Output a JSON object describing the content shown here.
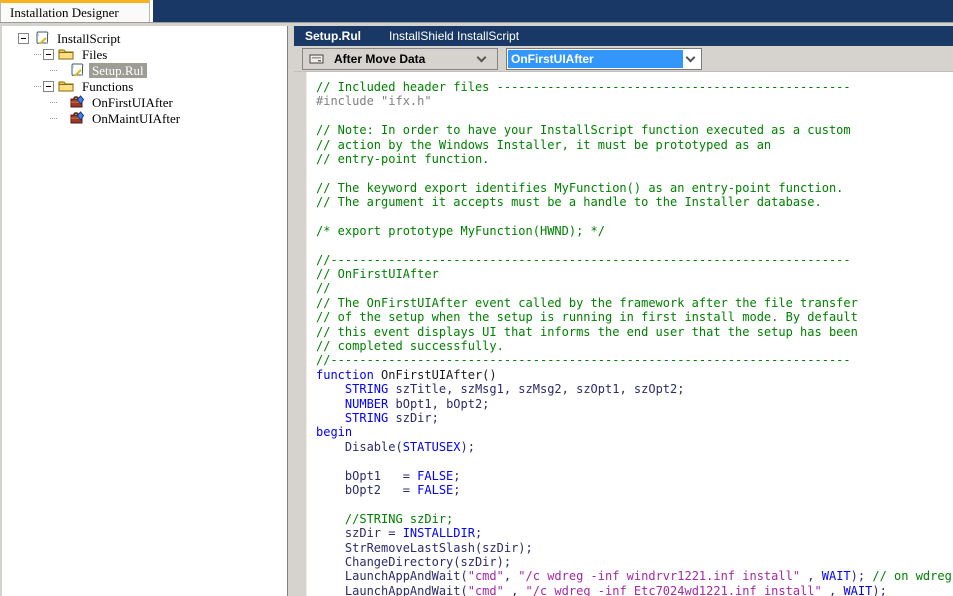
{
  "tab_bar": {
    "tab_label": "Installation Designer"
  },
  "tree": {
    "rows": [
      {
        "level": 0,
        "expand": true,
        "icon": "script-icon",
        "label": "InstallScript",
        "selected": false
      },
      {
        "level": 1,
        "expand": true,
        "icon": "folder-icon",
        "label": "Files",
        "selected": false
      },
      {
        "level": 2,
        "expand": false,
        "icon": "script-icon",
        "label": "Setup.Rul",
        "selected": true
      },
      {
        "level": 1,
        "expand": true,
        "icon": "folder-icon",
        "label": "Functions",
        "selected": false
      },
      {
        "level": 2,
        "expand": false,
        "icon": "function-icon",
        "label": "OnFirstUIAfter",
        "selected": false
      },
      {
        "level": 2,
        "expand": false,
        "icon": "function-icon",
        "label": "OnMaintUIAfter",
        "selected": false
      }
    ]
  },
  "doc_header": {
    "title": "Setup.Rul",
    "subtitle": "InstallShield InstallScript"
  },
  "toolbar": {
    "event_combo": {
      "icon": "event-icon",
      "label": "After Move Data"
    },
    "function_combo": {
      "value": "OnFirstUIAfter"
    }
  },
  "colors": {
    "navy": "#1a3866",
    "tab_accent": "#f9b11c",
    "toolbar_gray": "#d6d3ce",
    "sel_blue": "#3296fa",
    "tree_sel": "#9d9d95",
    "code_comment": "#008000",
    "code_preproc": "#808080",
    "code_keyword": "#0000ff",
    "code_ident": "#2b2b6b",
    "code_string": "#a428a4",
    "code_plain": "#1b1b1b"
  },
  "code": {
    "lines": [
      [
        [
          "comment",
          "// Included header files -------------------------------------------------"
        ]
      ],
      [
        [
          "preproc",
          "#include \"ifx.h\""
        ]
      ],
      [],
      [
        [
          "comment",
          "// Note: In order to have your InstallScript function executed as a custom"
        ]
      ],
      [
        [
          "comment",
          "// action by the Windows Installer, it must be prototyped as an"
        ]
      ],
      [
        [
          "comment",
          "// entry-point function."
        ]
      ],
      [],
      [
        [
          "comment",
          "// The keyword export identifies MyFunction() as an entry-point function."
        ]
      ],
      [
        [
          "comment",
          "// The argument it accepts must be a handle to the Installer database."
        ]
      ],
      [],
      [
        [
          "comment",
          "/* export prototype MyFunction(HWND); */"
        ]
      ],
      [],
      [
        [
          "comment",
          "//------------------------------------------------------------------------"
        ]
      ],
      [
        [
          "comment",
          "// OnFirstUIAfter"
        ]
      ],
      [
        [
          "comment",
          "//"
        ]
      ],
      [
        [
          "comment",
          "// The OnFirstUIAfter event called by the framework after the file transfer"
        ]
      ],
      [
        [
          "comment",
          "// of the setup when the setup is running in first install mode. By default"
        ]
      ],
      [
        [
          "comment",
          "// this event displays UI that informs the end user that the setup has been"
        ]
      ],
      [
        [
          "comment",
          "// completed successfully."
        ]
      ],
      [
        [
          "comment",
          "//------------------------------------------------------------------------"
        ]
      ],
      [
        [
          "keyword",
          "function"
        ],
        [
          "plain",
          " OnFirstUIAfter()"
        ]
      ],
      [
        [
          "plain",
          "    "
        ],
        [
          "keyword",
          "STRING"
        ],
        [
          "ident",
          " szTitle, szMsg1, szMsg2, szOpt1, szOpt2;"
        ]
      ],
      [
        [
          "plain",
          "    "
        ],
        [
          "keyword",
          "NUMBER"
        ],
        [
          "ident",
          " bOpt1, bOpt2;"
        ]
      ],
      [
        [
          "plain",
          "    "
        ],
        [
          "keyword",
          "STRING"
        ],
        [
          "ident",
          " szDir;"
        ]
      ],
      [
        [
          "keyword",
          "begin"
        ]
      ],
      [
        [
          "ident",
          "    Disable("
        ],
        [
          "keyword",
          "STATUSEX"
        ],
        [
          "ident",
          ");"
        ]
      ],
      [],
      [
        [
          "ident",
          "    bOpt1   = "
        ],
        [
          "keyword",
          "FALSE"
        ],
        [
          "ident",
          ";"
        ]
      ],
      [
        [
          "ident",
          "    bOpt2   = "
        ],
        [
          "keyword",
          "FALSE"
        ],
        [
          "ident",
          ";"
        ]
      ],
      [],
      [
        [
          "comment",
          "    //STRING szDir;"
        ]
      ],
      [
        [
          "ident",
          "    szDir = "
        ],
        [
          "keyword",
          "INSTALLDIR"
        ],
        [
          "ident",
          ";"
        ]
      ],
      [
        [
          "ident",
          "    StrRemoveLastSlash(szDir);"
        ]
      ],
      [
        [
          "ident",
          "    ChangeDirectory(szDir);"
        ]
      ],
      [
        [
          "ident",
          "    LaunchAppAndWait("
        ],
        [
          "string",
          "\"cmd\""
        ],
        [
          "ident",
          ", "
        ],
        [
          "string",
          "\"/c wdreg -inf windrvr1221.inf install\""
        ],
        [
          "ident",
          " , "
        ],
        [
          "keyword",
          "WAIT"
        ],
        [
          "ident",
          "); "
        ],
        [
          "comment",
          "// on wdreg.exe"
        ]
      ],
      [
        [
          "ident",
          "    LaunchAppAndWait("
        ],
        [
          "string",
          "\"cmd\""
        ],
        [
          "ident",
          " , "
        ],
        [
          "string",
          "\"/c wdreg -inf Etc7024wd1221.inf install\""
        ],
        [
          "ident",
          " , "
        ],
        [
          "keyword",
          "WAIT"
        ],
        [
          "ident",
          ");"
        ]
      ]
    ]
  }
}
